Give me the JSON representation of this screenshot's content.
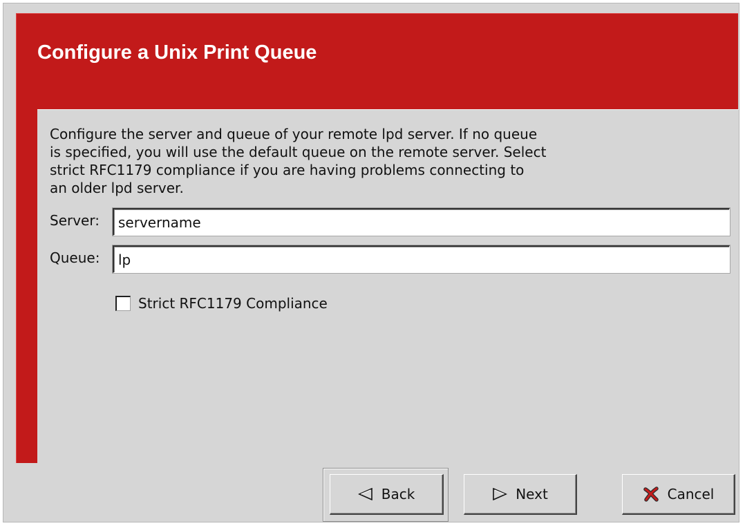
{
  "window": {
    "title": "Configure a Unix Print Queue"
  },
  "content": {
    "description": "Configure the server and queue of your remote lpd server. If no queue\nis specified, you will use the default queue on the remote server. Select\nstrict RFC1179 compliance if you are having problems connecting to\nan older lpd server.",
    "server": {
      "label": "Server:",
      "value": "servername"
    },
    "queue": {
      "label": "Queue:",
      "value": "lp"
    },
    "compliance": {
      "label": "Strict RFC1179 Compliance",
      "checked": false
    }
  },
  "buttons": {
    "back": {
      "label": "Back",
      "icon": "back-arrow-icon"
    },
    "next": {
      "label": "Next",
      "icon": "next-arrow-icon"
    },
    "cancel": {
      "label": "Cancel",
      "icon": "cancel-x-icon"
    }
  },
  "colors": {
    "header_red": "#c21a1a",
    "dialog_gray": "#d6d6d6",
    "field_white": "#ffffff"
  }
}
